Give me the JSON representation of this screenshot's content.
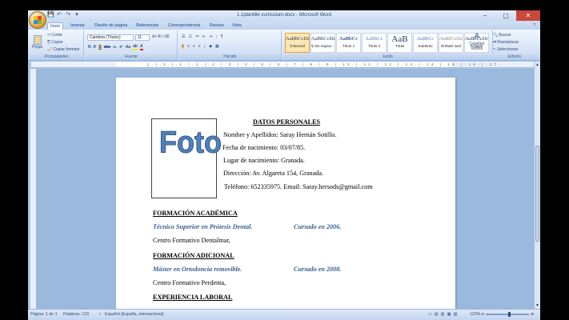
{
  "window": {
    "title": "1.1plantille curriculum.docx - Microsoft Word",
    "minimize": "–",
    "maximize": "▢",
    "close": "✕"
  },
  "quick_access": {
    "save": "💾",
    "undo": "↶",
    "redo": "↷",
    "more": "▾"
  },
  "tabs": [
    "Inicio",
    "Insertar",
    "Diseño de página",
    "Referencias",
    "Correspondencia",
    "Revisar",
    "Vista"
  ],
  "active_tab": "Inicio",
  "ribbon": {
    "clipboard": {
      "paste": "Pegar",
      "cut": "Cortar",
      "copy": "Copiar",
      "format_painter": "Copiar formato",
      "label": "Portapapeles"
    },
    "font": {
      "family": "Cambria (Títulos)",
      "size": "11",
      "label": "Fuente"
    },
    "paragraph": {
      "label": "Párrafo"
    },
    "styles": {
      "items": [
        {
          "preview": "AaBbCcDc",
          "name": "¶ Normal"
        },
        {
          "preview": "AaBbCcDc",
          "name": "¶ Sin espaci..."
        },
        {
          "preview": "AaBbCc",
          "name": "Título 1"
        },
        {
          "preview": "AaBbCc",
          "name": "Título 2"
        },
        {
          "preview": "AaB",
          "name": "Título"
        },
        {
          "preview": "AaBbCc",
          "name": "Subtítulo"
        },
        {
          "preview": "AaBbCcDc",
          "name": "Énfasis sutil"
        },
        {
          "preview": "AaBbCcDc",
          "name": "Énfasis"
        }
      ],
      "change_styles": "Cambiar estilos",
      "label": "Estilo"
    },
    "editing": {
      "find": "Buscar",
      "replace": "Reemplazar",
      "select": "Seleccionar",
      "label": "Edición"
    }
  },
  "ruler_numbers": "·1·|·2·|·1·|·1·|·2·|·3·|·4·|·5·|·6·|·7·|·8·|·9·|·10·|·11·|·12·|·13·|·14·|·15·|·16·|·17·",
  "document": {
    "photo_label": "Foto",
    "personal_heading": "DATOS PERSONALES",
    "name": "Nombre y Apellidos: Saray Hernán Sotillo.",
    "birth_date": "Fecha de nacimiento: 03/07/85.",
    "birth_place": "Lugar de nacimiento: Granada.",
    "address": "Dirección: Av. Algareta 154, Granada.",
    "phone_email": "Teléfono: 652335975. Email: Saray.hersods@gmail.com",
    "academic_heading": "FORMACIÓN ACADÉMICA",
    "academic_title": "Técnico Superior en Prótesis Dental.",
    "academic_year": "Cursado en 2006.",
    "academic_center": "Centro Formativo Dentalmar,",
    "additional_heading": "FORMACIÓN ADICIONAL",
    "additional_title": "Máster en Ortodoncia removible.",
    "additional_year": "Cursado en 2008.",
    "additional_center": "Centro Formativo Perdenta,",
    "experience_heading": "EXPERIENCIA LABORAL"
  },
  "statusbar": {
    "page": "Página: 1 de 1",
    "words": "Palabras: 133",
    "language": "Español (España, internacional)",
    "zoom": "120%",
    "zoom_fraction": 0.55
  }
}
